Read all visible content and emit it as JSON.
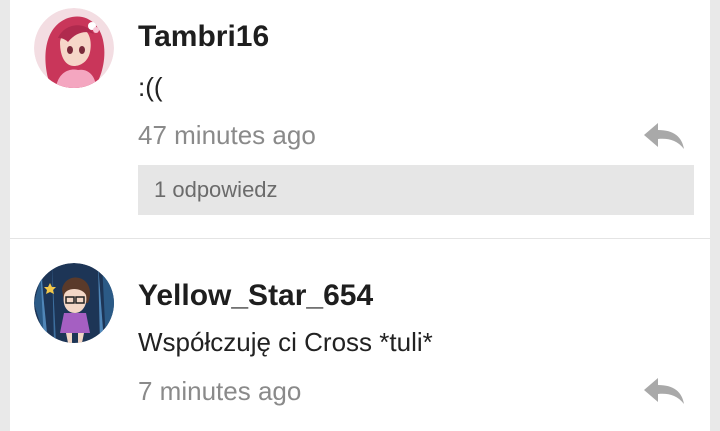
{
  "comments": [
    {
      "username": "Tambri16",
      "text": ":((",
      "time": "47 minutes ago",
      "replies_label": "1 odpowiedz",
      "avatar_icon": "anime-girl-pink-hair-avatar"
    },
    {
      "username": "Yellow_Star_654",
      "text": "Współczuję ci Cross *tuli*",
      "time": "7 minutes ago",
      "avatar_icon": "anime-girl-night-forest-avatar"
    }
  ],
  "colors": {
    "background": "#e9e9e9",
    "card": "#ffffff",
    "username": "#1e1e1e",
    "timestamp": "#8a8a8a",
    "reply_icon": "#a9a9a9",
    "replies_bar": "#e6e6e6"
  }
}
